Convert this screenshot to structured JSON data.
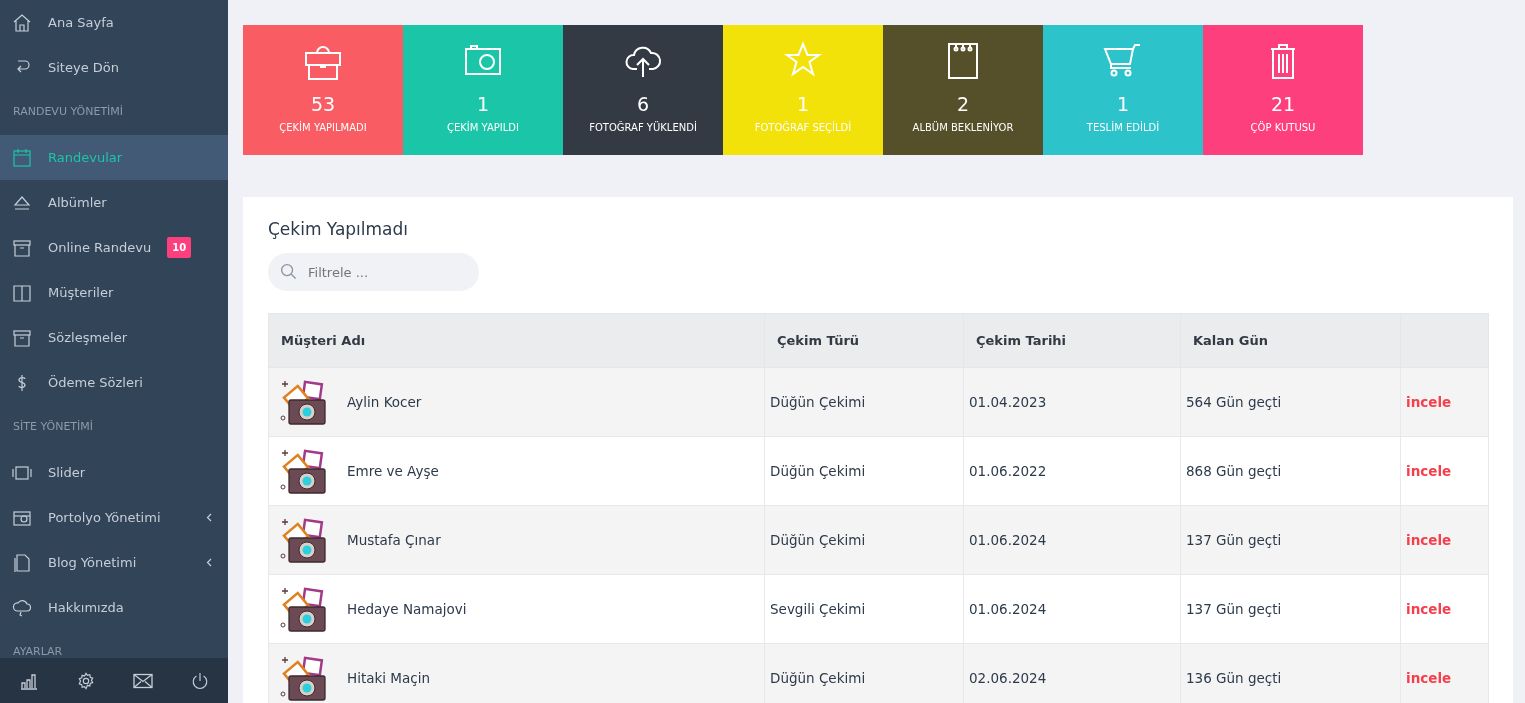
{
  "sidebar": {
    "items": [
      {
        "kind": "item",
        "label": "Ana Sayfa",
        "selected": false,
        "submenu": false
      },
      {
        "kind": "item",
        "label": "Siteye Dön",
        "selected": false,
        "submenu": false
      },
      {
        "kind": "header",
        "label": "RANDEVU YÖNETİMİ"
      },
      {
        "kind": "item",
        "label": "Randevular",
        "selected": true,
        "submenu": false
      },
      {
        "kind": "item",
        "label": "Albümler",
        "selected": false,
        "submenu": false
      },
      {
        "kind": "item",
        "label": "Online Randevu",
        "selected": false,
        "submenu": false,
        "badge": "10"
      },
      {
        "kind": "item",
        "label": "Müşteriler",
        "selected": false,
        "submenu": false
      },
      {
        "kind": "item",
        "label": "Sözleşmeler",
        "selected": false,
        "submenu": false
      },
      {
        "kind": "item",
        "label": "Ödeme Sözleri",
        "selected": false,
        "submenu": false
      },
      {
        "kind": "header",
        "label": "SİTE YÖNETİMİ"
      },
      {
        "kind": "item",
        "label": "Slider",
        "selected": false,
        "submenu": false
      },
      {
        "kind": "item",
        "label": "Portolyo Yönetimi",
        "selected": false,
        "submenu": true
      },
      {
        "kind": "item",
        "label": "Blog Yönetimi",
        "selected": false,
        "submenu": true
      },
      {
        "kind": "item",
        "label": "Hakkımızda",
        "selected": false,
        "submenu": false
      },
      {
        "kind": "header",
        "label": "AYARLAR"
      }
    ]
  },
  "stats": [
    {
      "count": "53",
      "label": "ÇEKİM YAPILMADI",
      "color": "#f95c63"
    },
    {
      "count": "1",
      "label": "ÇEKİM YAPILDI",
      "color": "#1bc5a7"
    },
    {
      "count": "6",
      "label": "FOTOĞRAF YÜKLENDİ",
      "color": "#343a44"
    },
    {
      "count": "1",
      "label": "FOTOĞRAF SEÇİLDİ",
      "color": "#f3e20a"
    },
    {
      "count": "2",
      "label": "ALBÜM BEKLENİYOR",
      "color": "#555029"
    },
    {
      "count": "1",
      "label": "TESLİM EDİLDİ",
      "color": "#2cc3cb"
    },
    {
      "count": "21",
      "label": "ÇÖP KUTUSU",
      "color": "#fe3f7e"
    }
  ],
  "panel": {
    "title": "Çekim Yapılmadı",
    "search": {
      "placeholder": "Filtrele ..."
    },
    "table": {
      "columns": [
        "Müşteri Adı",
        "Çekim Türü",
        "Çekim Tarihi",
        "Kalan Gün"
      ],
      "rows": [
        {
          "name": "Aylin Kocer",
          "type": "Düğün Çekimi",
          "date": "01.04.2023",
          "days": "564 Gün geçti",
          "action": "incele"
        },
        {
          "name": "Emre ve Ayşe",
          "type": "Düğün Çekimi",
          "date": "01.06.2022",
          "days": "868 Gün geçti",
          "action": "incele"
        },
        {
          "name": "Mustafa Çınar",
          "type": "Düğün Çekimi",
          "date": "01.06.2024",
          "days": "137 Gün geçti",
          "action": "incele"
        },
        {
          "name": "Hedaye Namajovi",
          "type": "Sevgili Çekimi",
          "date": "01.06.2024",
          "days": "137 Gün geçti",
          "action": "incele"
        },
        {
          "name": "Hitaki Maçin",
          "type": "Düğün Çekimi",
          "date": "02.06.2024",
          "days": "136 Gün geçti",
          "action": "incele"
        }
      ]
    }
  }
}
